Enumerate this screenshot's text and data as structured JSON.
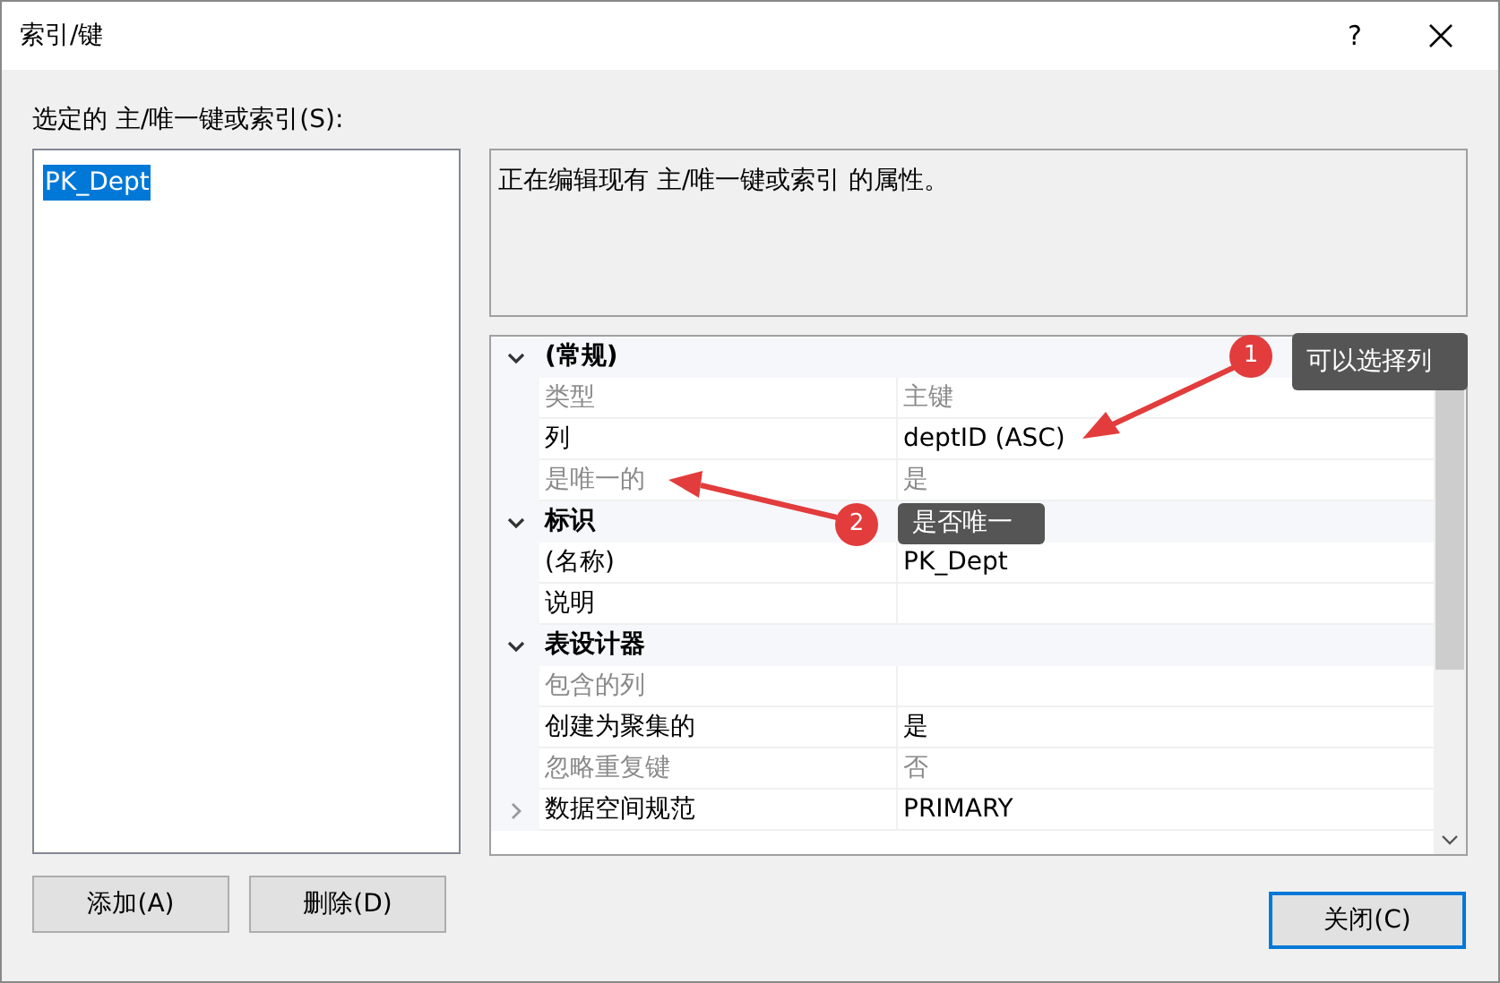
{
  "window": {
    "title": "索引/键",
    "help": "?"
  },
  "list_label": "选定的 主/唯一键或索引(S):",
  "list_items": [
    {
      "label": "PK_Dept",
      "selected": true
    }
  ],
  "description": "正在编辑现有 主/唯一键或索引 的属性。",
  "properties": [
    {
      "kind": "category",
      "name": "(常规)",
      "expanded": true
    },
    {
      "kind": "property",
      "name": "类型",
      "value": "主键",
      "disabled": true
    },
    {
      "kind": "property",
      "name": "列",
      "value": "deptID (ASC)",
      "disabled": false
    },
    {
      "kind": "property",
      "name": "是唯一的",
      "value": "是",
      "disabled": true
    },
    {
      "kind": "category",
      "name": "标识",
      "expanded": true
    },
    {
      "kind": "property",
      "name": "(名称)",
      "value": "PK_Dept",
      "disabled": false
    },
    {
      "kind": "property",
      "name": "说明",
      "disabled": false
    },
    {
      "kind": "category",
      "name": "表设计器",
      "expanded": true
    },
    {
      "kind": "property",
      "name": "包含的列",
      "disabled": true
    },
    {
      "kind": "property",
      "name": "创建为聚集的",
      "value": "是",
      "disabled": false
    },
    {
      "kind": "property",
      "name": "忽略重复键",
      "value": "否",
      "disabled": true
    },
    {
      "kind": "property",
      "name": "数据空间规范",
      "value": "PRIMARY",
      "disabled": false,
      "expanded": false
    }
  ],
  "buttons": [
    {
      "label": "添加(A)",
      "default": false
    },
    {
      "label": "删除(D)",
      "default": false
    },
    {
      "label": "关闭(C)",
      "default": true
    }
  ],
  "annotations": [
    {
      "number": "1",
      "text": "可以选择列"
    },
    {
      "number": "2",
      "text": "是否唯一"
    }
  ]
}
